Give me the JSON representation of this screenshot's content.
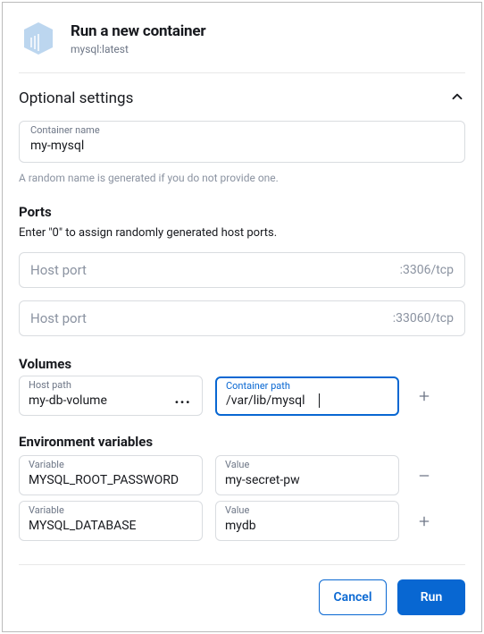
{
  "header": {
    "title": "Run a new container",
    "subtitle": "mysql:latest"
  },
  "accordion": {
    "title": "Optional settings"
  },
  "container_name": {
    "label": "Container name",
    "value": "my-mysql",
    "hint": "A random name is generated if you do not provide one."
  },
  "ports": {
    "title": "Ports",
    "hint": "Enter \"0\" to assign randomly generated host ports.",
    "rows": [
      {
        "placeholder": "Host port",
        "suffix": ":3306/tcp",
        "value": ""
      },
      {
        "placeholder": "Host port",
        "suffix": ":33060/tcp",
        "value": ""
      }
    ]
  },
  "volumes": {
    "title": "Volumes",
    "host": {
      "label": "Host path",
      "value": "my-db-volume"
    },
    "container": {
      "label": "Container path",
      "value": "/var/lib/mysql"
    }
  },
  "env": {
    "title": "Environment variables",
    "rows": [
      {
        "var_label": "Variable",
        "var_value": "MYSQL_ROOT_PASSWORD",
        "val_label": "Value",
        "val_value": "my-secret-pw",
        "action": "minus"
      },
      {
        "var_label": "Variable",
        "var_value": "MYSQL_DATABASE",
        "val_label": "Value",
        "val_value": "mydb",
        "action": "plus"
      }
    ]
  },
  "footer": {
    "cancel": "Cancel",
    "run": "Run"
  }
}
